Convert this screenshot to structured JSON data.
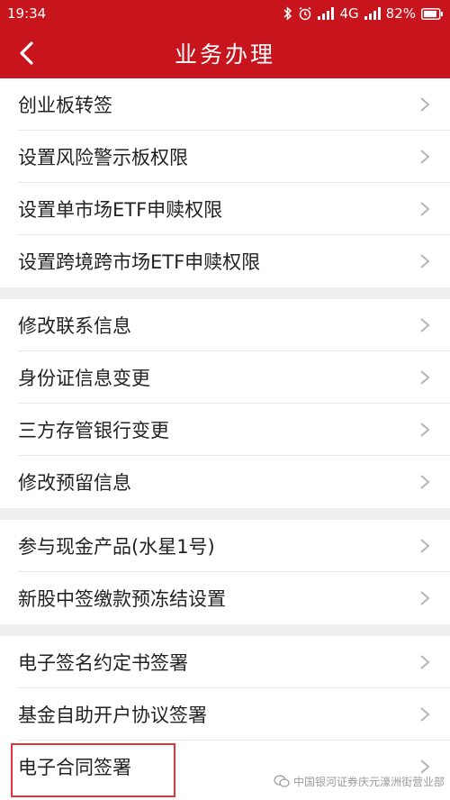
{
  "status": {
    "time": "19:34",
    "network": "4G",
    "battery": "82%"
  },
  "header": {
    "title": "业务办理"
  },
  "groups": [
    {
      "items": [
        {
          "label": "创业板转签"
        },
        {
          "label": "设置风险警示板权限"
        },
        {
          "label": "设置单市场ETF申赎权限"
        },
        {
          "label": "设置跨境跨市场ETF申赎权限"
        }
      ]
    },
    {
      "items": [
        {
          "label": "修改联系信息"
        },
        {
          "label": "身份证信息变更"
        },
        {
          "label": "三方存管银行变更"
        },
        {
          "label": "修改预留信息"
        }
      ]
    },
    {
      "items": [
        {
          "label": "参与现金产品(水星1号)"
        },
        {
          "label": "新股中签缴款预冻结设置"
        }
      ]
    },
    {
      "items": [
        {
          "label": "电子签名约定书签署"
        },
        {
          "label": "基金自助开户协议签署"
        },
        {
          "label": "电子合同签署"
        }
      ]
    }
  ],
  "watermark": {
    "text": "中国银河证券庆元濠洲街营业部"
  },
  "colors": {
    "brand": "#c8141c",
    "highlight": "#e8323a"
  }
}
